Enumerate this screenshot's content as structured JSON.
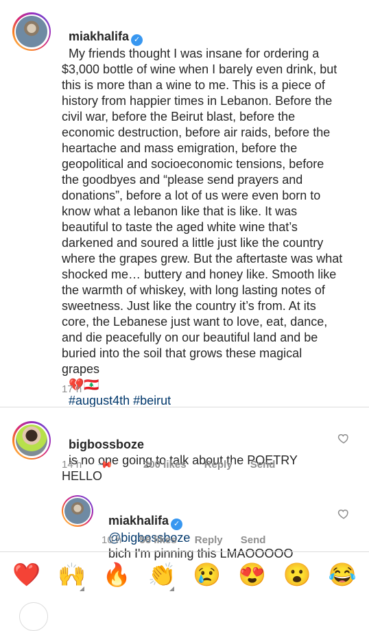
{
  "post": {
    "username": "miakhalifa",
    "caption": "My friends thought I was insane for ordering a $3,000 bottle of wine when I barely even drink, but this is more than a wine to me. This is a piece of history from happier times in Lebanon. Before the civil war, before the Beirut blast, before the economic destruction, before air raids, before the heartache and mass emigration, before the geopolitical and socioeconomic tensions, before the goodbyes and “please send prayers and donations”, before a lot of us were even born to know what a lebanon like that is like. It was beautiful to taste the aged white wine that’s darkened and soured a little just like the country where the grapes grew. But the aftertaste was what shocked me… buttery and honey like. Smooth like the warmth of whiskey, with long lasting notes of sweetness. Just like the country it’s from. At its core, the Lebanese just want to love, eat, dance, and die peacefully on our beautiful land and be buried into the soil that grows these magical grapes",
    "emojis": "💔🇱🇧",
    "hashtags": "#august4th #beirut",
    "time": "17 h"
  },
  "comment": {
    "username": "bigbossboze",
    "text": "is no one going to talk about the POETRY HELLO",
    "time": "14 h",
    "likes": "200 likes",
    "reply": "Reply",
    "send": "Send"
  },
  "reply": {
    "username": "miakhalifa",
    "mention": "@bigbossboze",
    "text": "bich I'm pinning this LMAOOOOO",
    "time": "10 h",
    "likes": "56 likes",
    "reply": "Reply",
    "send": "Send"
  },
  "emoji_bar": [
    "❤️",
    "🙌",
    "🔥",
    "👏",
    "😢",
    "😍",
    "😮",
    "😂"
  ]
}
